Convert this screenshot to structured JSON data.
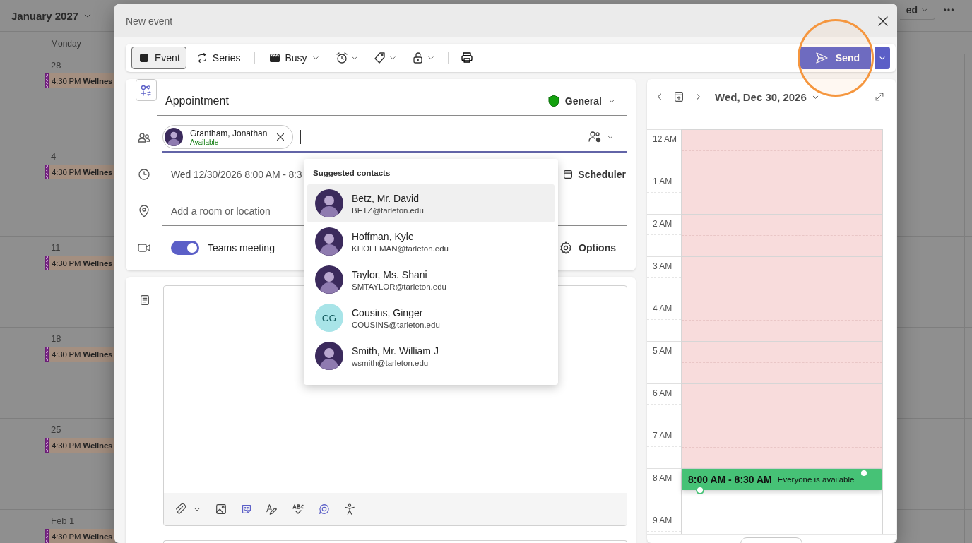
{
  "calendar": {
    "month": "January 2027",
    "view_menu": "ed",
    "day_header": "Monday",
    "weeks": [
      {
        "date": "28",
        "event": {
          "time": "4:30 PM",
          "title": "Wellnes"
        }
      },
      {
        "date": "4",
        "event": {
          "time": "4:30 PM",
          "title": "Wellnes"
        }
      },
      {
        "date": "11",
        "event": {
          "time": "4:30 PM",
          "title": "Wellnes"
        }
      },
      {
        "date": "18",
        "event": {
          "time": "4:30 PM",
          "title": "Wellnes"
        }
      },
      {
        "date": "25",
        "event": {
          "time": "4:30 PM",
          "title": "Wellnes"
        }
      },
      {
        "date": "Feb 1",
        "event": {
          "time": "4:30 PM",
          "title": "Wellnes"
        }
      }
    ]
  },
  "dialog": {
    "title": "New event",
    "toolbar": {
      "modes": [
        {
          "label": "Event",
          "selected": true
        },
        {
          "label": "Series",
          "selected": false
        }
      ],
      "show_as": "Busy",
      "send": "Send"
    },
    "form": {
      "title": "Appointment",
      "category": "General",
      "attendees": [
        {
          "name": "Grantham, Jonathan",
          "status": "Available"
        }
      ],
      "datetime": "Wed 12/30/2026 8:00 AM - 8:3",
      "scheduler": "Scheduler",
      "location": {
        "placeholder": "Add a room or location"
      },
      "teams_meeting": {
        "label": "Teams meeting",
        "on": true
      },
      "options": "Options"
    },
    "suggestions": {
      "title": "Suggested contacts",
      "contacts": [
        {
          "name": "Betz, Mr. David",
          "email": "BETZ@tarleton.edu",
          "selected": true
        },
        {
          "name": "Hoffman, Kyle",
          "email": "KHOFFMAN@tarleton.edu",
          "selected": false
        },
        {
          "name": "Taylor, Ms. Shani",
          "email": "SMTAYLOR@tarleton.edu",
          "selected": false
        },
        {
          "name": "Cousins, Ginger",
          "email": "COUSINS@tarleton.edu",
          "avatar": {
            "kind": "initials",
            "initials": "CG"
          },
          "selected": false
        },
        {
          "name": "Smith, Mr. William J",
          "email": "wsmith@tarleton.edu",
          "selected": false
        }
      ]
    },
    "scheduler": {
      "date": "Wed, Dec 30, 2026",
      "hours": [
        {
          "label": "12 AM",
          "busy": true
        },
        {
          "label": "1 AM",
          "busy": true
        },
        {
          "label": "2 AM",
          "busy": true
        },
        {
          "label": "3 AM",
          "busy": true
        },
        {
          "label": "4 AM",
          "busy": true
        },
        {
          "label": "5 AM",
          "busy": true
        },
        {
          "label": "6 AM",
          "busy": true
        },
        {
          "label": "7 AM",
          "busy": true
        },
        {
          "label": "8 AM",
          "busy": false,
          "event": {
            "time": "8:00 AM - 8:30 AM",
            "note": "Everyone is available"
          }
        },
        {
          "label": "9 AM",
          "busy": false
        }
      ]
    }
  },
  "annotation": {
    "kind": "circle"
  }
}
